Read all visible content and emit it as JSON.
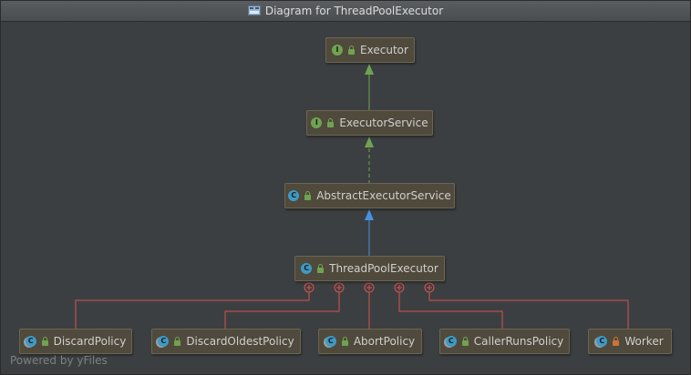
{
  "window": {
    "title": "Diagram for ThreadPoolExecutor",
    "icon": "diagram-icon"
  },
  "nodes": {
    "executor": {
      "label": "Executor",
      "kind": "I",
      "visibility": "public"
    },
    "executor_service": {
      "label": "ExecutorService",
      "kind": "I",
      "visibility": "public"
    },
    "abstract_executor_service": {
      "label": "AbstractExecutorService",
      "kind": "C",
      "visibility": "public"
    },
    "thread_pool_executor": {
      "label": "ThreadPoolExecutor",
      "kind": "C",
      "visibility": "public"
    },
    "discard_policy": {
      "label": "DiscardPolicy",
      "kind": "C",
      "visibility": "public"
    },
    "discard_oldest_policy": {
      "label": "DiscardOldestPolicy",
      "kind": "C",
      "visibility": "public"
    },
    "abort_policy": {
      "label": "AbortPolicy",
      "kind": "C",
      "visibility": "public"
    },
    "caller_runs_policy": {
      "label": "CallerRunsPolicy",
      "kind": "C",
      "visibility": "public"
    },
    "worker": {
      "label": "Worker",
      "kind": "C",
      "visibility": "private"
    }
  },
  "relations": [
    {
      "from": "ExecutorService",
      "to": "Executor",
      "type": "extends"
    },
    {
      "from": "AbstractExecutorService",
      "to": "ExecutorService",
      "type": "implements"
    },
    {
      "from": "ThreadPoolExecutor",
      "to": "AbstractExecutorService",
      "type": "extends"
    },
    {
      "from": "DiscardPolicy",
      "to": "ThreadPoolExecutor",
      "type": "inner-class"
    },
    {
      "from": "DiscardOldestPolicy",
      "to": "ThreadPoolExecutor",
      "type": "inner-class"
    },
    {
      "from": "AbortPolicy",
      "to": "ThreadPoolExecutor",
      "type": "inner-class"
    },
    {
      "from": "CallerRunsPolicy",
      "to": "ThreadPoolExecutor",
      "type": "inner-class"
    },
    {
      "from": "Worker",
      "to": "ThreadPoolExecutor",
      "type": "inner-class"
    }
  ],
  "colors": {
    "extends_interface": "#6fa351",
    "implements": "#6fa351",
    "extends_class": "#4a90e0",
    "inner_class": "#d9534f",
    "node_fill": "#4f4a3c",
    "background": "#3c3f41"
  },
  "footer": {
    "text": "Powered by yFiles"
  }
}
